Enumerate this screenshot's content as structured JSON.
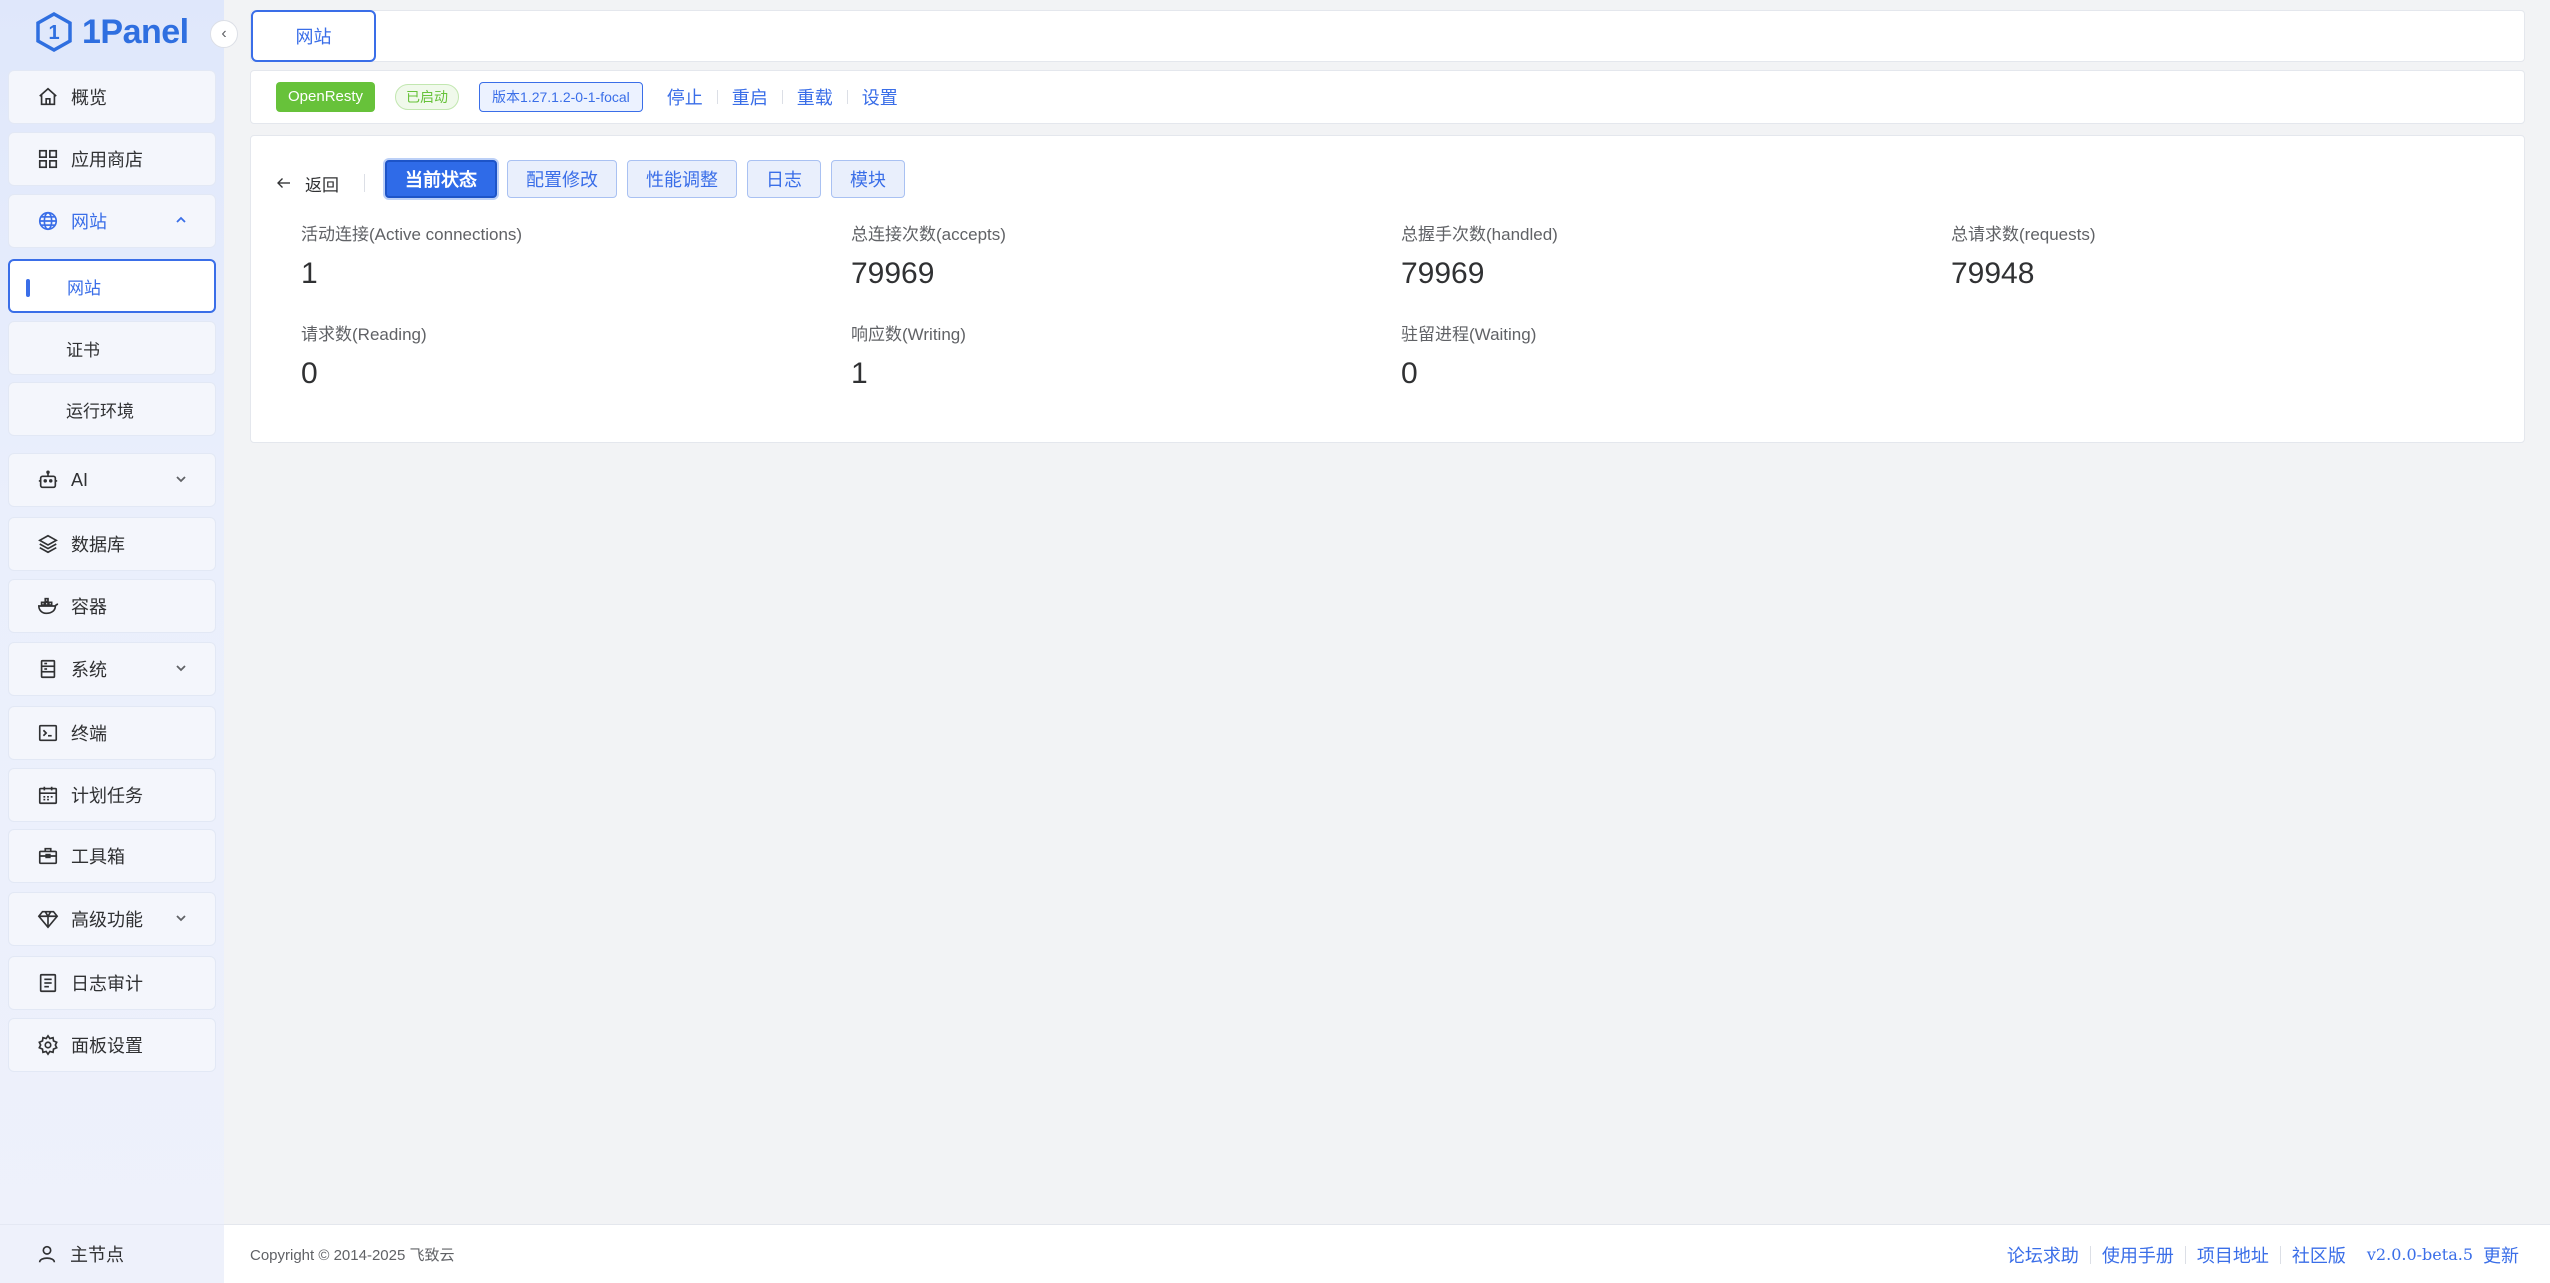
{
  "app": {
    "logo_text": "1Panel"
  },
  "sidebar": {
    "items": [
      {
        "label": "概览",
        "icon": "home-icon"
      },
      {
        "label": "应用商店",
        "icon": "apps-grid-icon"
      },
      {
        "label": "网站",
        "icon": "globe-icon",
        "expanded": true,
        "children": [
          {
            "label": "网站",
            "active": true
          },
          {
            "label": "证书"
          },
          {
            "label": "运行环境"
          }
        ]
      },
      {
        "label": "AI",
        "icon": "robot-icon",
        "expandable": true
      },
      {
        "label": "数据库",
        "icon": "layers-icon"
      },
      {
        "label": "容器",
        "icon": "docker-icon"
      },
      {
        "label": "系统",
        "icon": "server-icon",
        "expandable": true
      },
      {
        "label": "终端",
        "icon": "terminal-icon"
      },
      {
        "label": "计划任务",
        "icon": "calendar-icon"
      },
      {
        "label": "工具箱",
        "icon": "toolbox-icon"
      },
      {
        "label": "高级功能",
        "icon": "diamond-icon",
        "expandable": true
      },
      {
        "label": "日志审计",
        "icon": "log-icon"
      },
      {
        "label": "面板设置",
        "icon": "gear-icon"
      }
    ],
    "footer": {
      "label": "主节点",
      "icon": "user-icon"
    }
  },
  "topbar": {
    "tab_label": "网站"
  },
  "status": {
    "app_name": "OpenResty",
    "state": "已启动",
    "version": "版本1.27.1.2-0-1-focal",
    "actions": [
      "停止",
      "重启",
      "重载",
      "设置"
    ]
  },
  "panel": {
    "back_label": "返回",
    "tabs": [
      "当前状态",
      "配置修改",
      "性能调整",
      "日志",
      "模块"
    ],
    "active_tab": "当前状态",
    "stats": [
      {
        "label": "活动连接(Active connections)",
        "value": "1"
      },
      {
        "label": "总连接次数(accepts)",
        "value": "79969"
      },
      {
        "label": "总握手次数(handled)",
        "value": "79969"
      },
      {
        "label": "总请求数(requests)",
        "value": "79948"
      },
      {
        "label": "请求数(Reading)",
        "value": "0"
      },
      {
        "label": "响应数(Writing)",
        "value": "1"
      },
      {
        "label": "驻留进程(Waiting)",
        "value": "0"
      }
    ]
  },
  "footer": {
    "copyright": "Copyright © 2014-2025 飞致云",
    "links": [
      "论坛求助",
      "使用手册",
      "项目地址",
      "社区版"
    ],
    "version": "v2.0.0-beta.5",
    "update_label": "更新"
  },
  "colors": {
    "primary": "#3a6ee8",
    "success": "#67c23a",
    "sidebar_bg": "#e6ecfb"
  }
}
